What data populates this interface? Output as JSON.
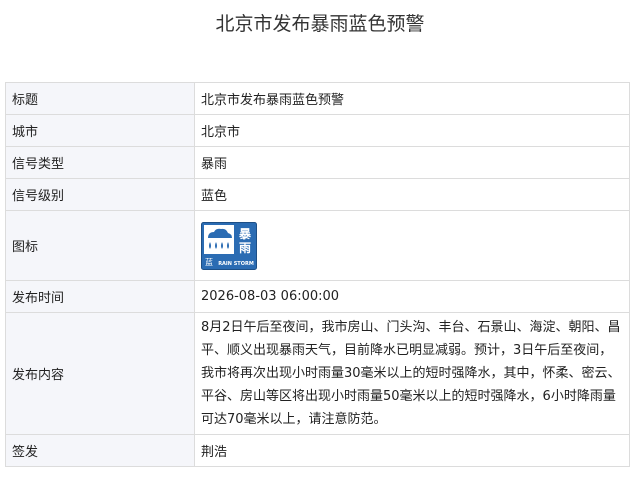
{
  "page": {
    "title": "北京市发布暴雨蓝色预警"
  },
  "rows": [
    {
      "label": "标题",
      "value": "北京市发布暴雨蓝色预警"
    },
    {
      "label": "城市",
      "value": "北京市"
    },
    {
      "label": "信号类型",
      "value": "暴雨"
    },
    {
      "label": "信号级别",
      "value": "蓝色"
    },
    {
      "label": "图标"
    },
    {
      "label": "发布时间",
      "value": "2026-08-03 06:00:00"
    },
    {
      "label": "发布内容",
      "value": "8月2日午后至夜间，我市房山、门头沟、丰台、石景山、海淀、朝阳、昌平、顺义出现暴雨天气，目前降水已明显减弱。预计，3日午后至夜间，我市将再次出现小时雨量30毫米以上的短时强降水，其中，怀柔、密云、平谷、房山等区将出现小时雨量50毫米以上的短时强降水，6小时降雨量可达70毫米以上，请注意防范。"
    },
    {
      "label": "签发",
      "value": "荆浩"
    }
  ],
  "icon": {
    "name": "rainstorm-blue-warning-icon",
    "char_top": "暴",
    "char_bottom": "雨",
    "level_char": "蓝",
    "caption": "RAIN STORM",
    "color": "#2b6cb3"
  },
  "colors": {
    "label_bg": "#f5f6fa",
    "border": "#dcdcdc"
  }
}
